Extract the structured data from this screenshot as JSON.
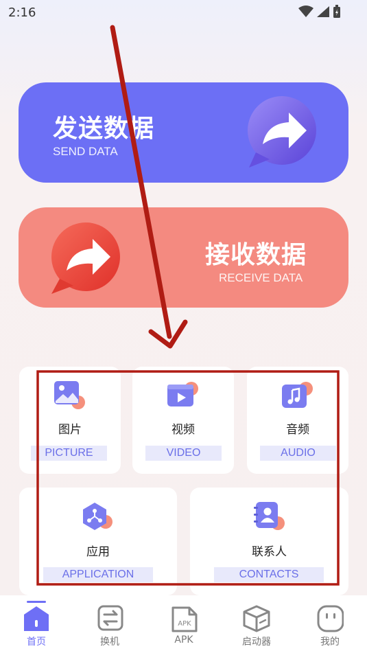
{
  "status_bar": {
    "time": "2:16"
  },
  "send_card": {
    "title": "发送数据",
    "subtitle": "SEND DATA"
  },
  "receive_card": {
    "title": "接收数据",
    "subtitle": "RECEIVE DATA"
  },
  "categories": [
    {
      "label": "图片",
      "en": "PICTURE",
      "icon": "image-icon"
    },
    {
      "label": "视频",
      "en": "VIDEO",
      "icon": "video-icon"
    },
    {
      "label": "音频",
      "en": "AUDIO",
      "icon": "music-icon"
    },
    {
      "label": "应用",
      "en": "APPLICATION",
      "icon": "app-icon"
    },
    {
      "label": "联系人",
      "en": "CONTACTS",
      "icon": "contacts-icon"
    }
  ],
  "bottom_nav": {
    "items": [
      {
        "label": "首页",
        "icon": "home-icon",
        "active": true
      },
      {
        "label": "换机",
        "icon": "switch-icon",
        "active": false
      },
      {
        "label": "APK",
        "icon": "apk-icon",
        "active": false
      },
      {
        "label": "启动器",
        "icon": "box-icon",
        "active": false
      },
      {
        "label": "我的",
        "icon": "profile-icon",
        "active": false
      }
    ]
  },
  "apk_badge": "APK",
  "colors": {
    "send": "#6c6ff5",
    "receive": "#f48a80",
    "accent": "#6e6ff5",
    "annotation": "#b01c14"
  }
}
